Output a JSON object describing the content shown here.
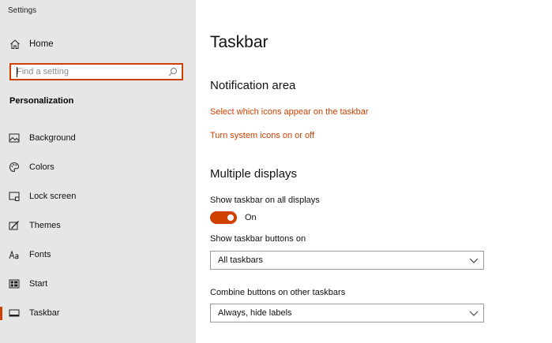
{
  "app": {
    "title": "Settings"
  },
  "sidebar": {
    "home_label": "Home",
    "search_placeholder": "Find a setting",
    "section_title": "Personalization",
    "items": [
      {
        "label": "Background",
        "icon": "image-icon"
      },
      {
        "label": "Colors",
        "icon": "palette-icon"
      },
      {
        "label": "Lock screen",
        "icon": "lock-screen-icon"
      },
      {
        "label": "Themes",
        "icon": "brush-icon"
      },
      {
        "label": "Fonts",
        "icon": "font-icon"
      },
      {
        "label": "Start",
        "icon": "start-icon"
      },
      {
        "label": "Taskbar",
        "icon": "taskbar-icon",
        "active": true
      }
    ]
  },
  "main": {
    "title": "Taskbar",
    "notification_area": {
      "heading": "Notification area",
      "links": [
        "Select which icons appear on the taskbar",
        "Turn system icons on or off"
      ]
    },
    "multiple_displays": {
      "heading": "Multiple displays",
      "show_on_all_label": "Show taskbar on all displays",
      "toggle_state": "On",
      "show_buttons_label": "Show taskbar buttons on",
      "show_buttons_value": "All taskbars",
      "combine_label": "Combine buttons on other taskbars",
      "combine_value": "Always, hide labels"
    }
  },
  "colors": {
    "accent": "#d04000",
    "sidebar_bg": "#e6e6e6",
    "content_bg": "#ffffff"
  }
}
